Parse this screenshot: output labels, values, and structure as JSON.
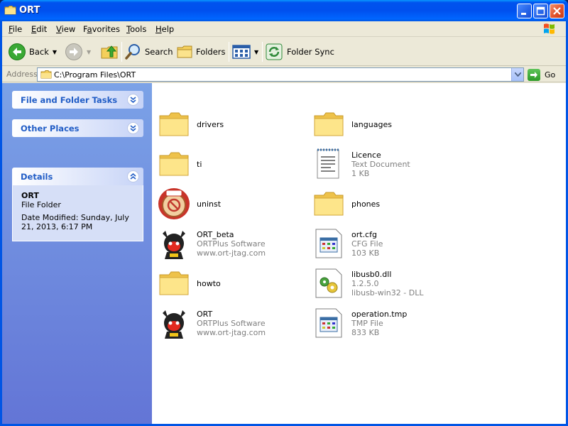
{
  "window": {
    "title": "ORT"
  },
  "menu": [
    {
      "label": "File",
      "accel": "F"
    },
    {
      "label": "Edit",
      "accel": "E"
    },
    {
      "label": "View",
      "accel": "V"
    },
    {
      "label": "Favorites",
      "accel": "a"
    },
    {
      "label": "Tools",
      "accel": "T"
    },
    {
      "label": "Help",
      "accel": "H"
    }
  ],
  "toolbar": {
    "back_label": "Back",
    "search_label": "Search",
    "folders_label": "Folders",
    "folder_sync_label": "Folder Sync"
  },
  "address": {
    "label": "Address",
    "value": "C:\\Program Files\\ORT",
    "go_label": "Go"
  },
  "tasks": {
    "file_folder_tasks": "File and Folder Tasks",
    "other_places": "Other Places",
    "details": "Details",
    "details_name": "ORT",
    "details_type": "File Folder",
    "details_date": "Date Modified: Sunday, July 21, 2013, 6:17 PM"
  },
  "files": {
    "drivers": {
      "name": "drivers"
    },
    "ti": {
      "name": "ti"
    },
    "uninst": {
      "name": "uninst"
    },
    "ort_beta": {
      "name": "ORT_beta",
      "line2": "ORTPlus Software",
      "line3": "www.ort-jtag.com"
    },
    "howto": {
      "name": "howto"
    },
    "ort": {
      "name": "ORT",
      "line2": "ORTPlus Software",
      "line3": "www.ort-jtag.com"
    },
    "languages": {
      "name": "languages"
    },
    "licence": {
      "name": "Licence",
      "line2": "Text Document",
      "line3": "1 KB"
    },
    "phones": {
      "name": "phones"
    },
    "ort_cfg": {
      "name": "ort.cfg",
      "line2": "CFG File",
      "line3": "103 KB"
    },
    "libusb": {
      "name": "libusb0.dll",
      "line2": "1.2.5.0",
      "line3": "libusb-win32 - DLL"
    },
    "operation": {
      "name": "operation.tmp",
      "line2": "TMP File",
      "line3": "833 KB"
    }
  }
}
